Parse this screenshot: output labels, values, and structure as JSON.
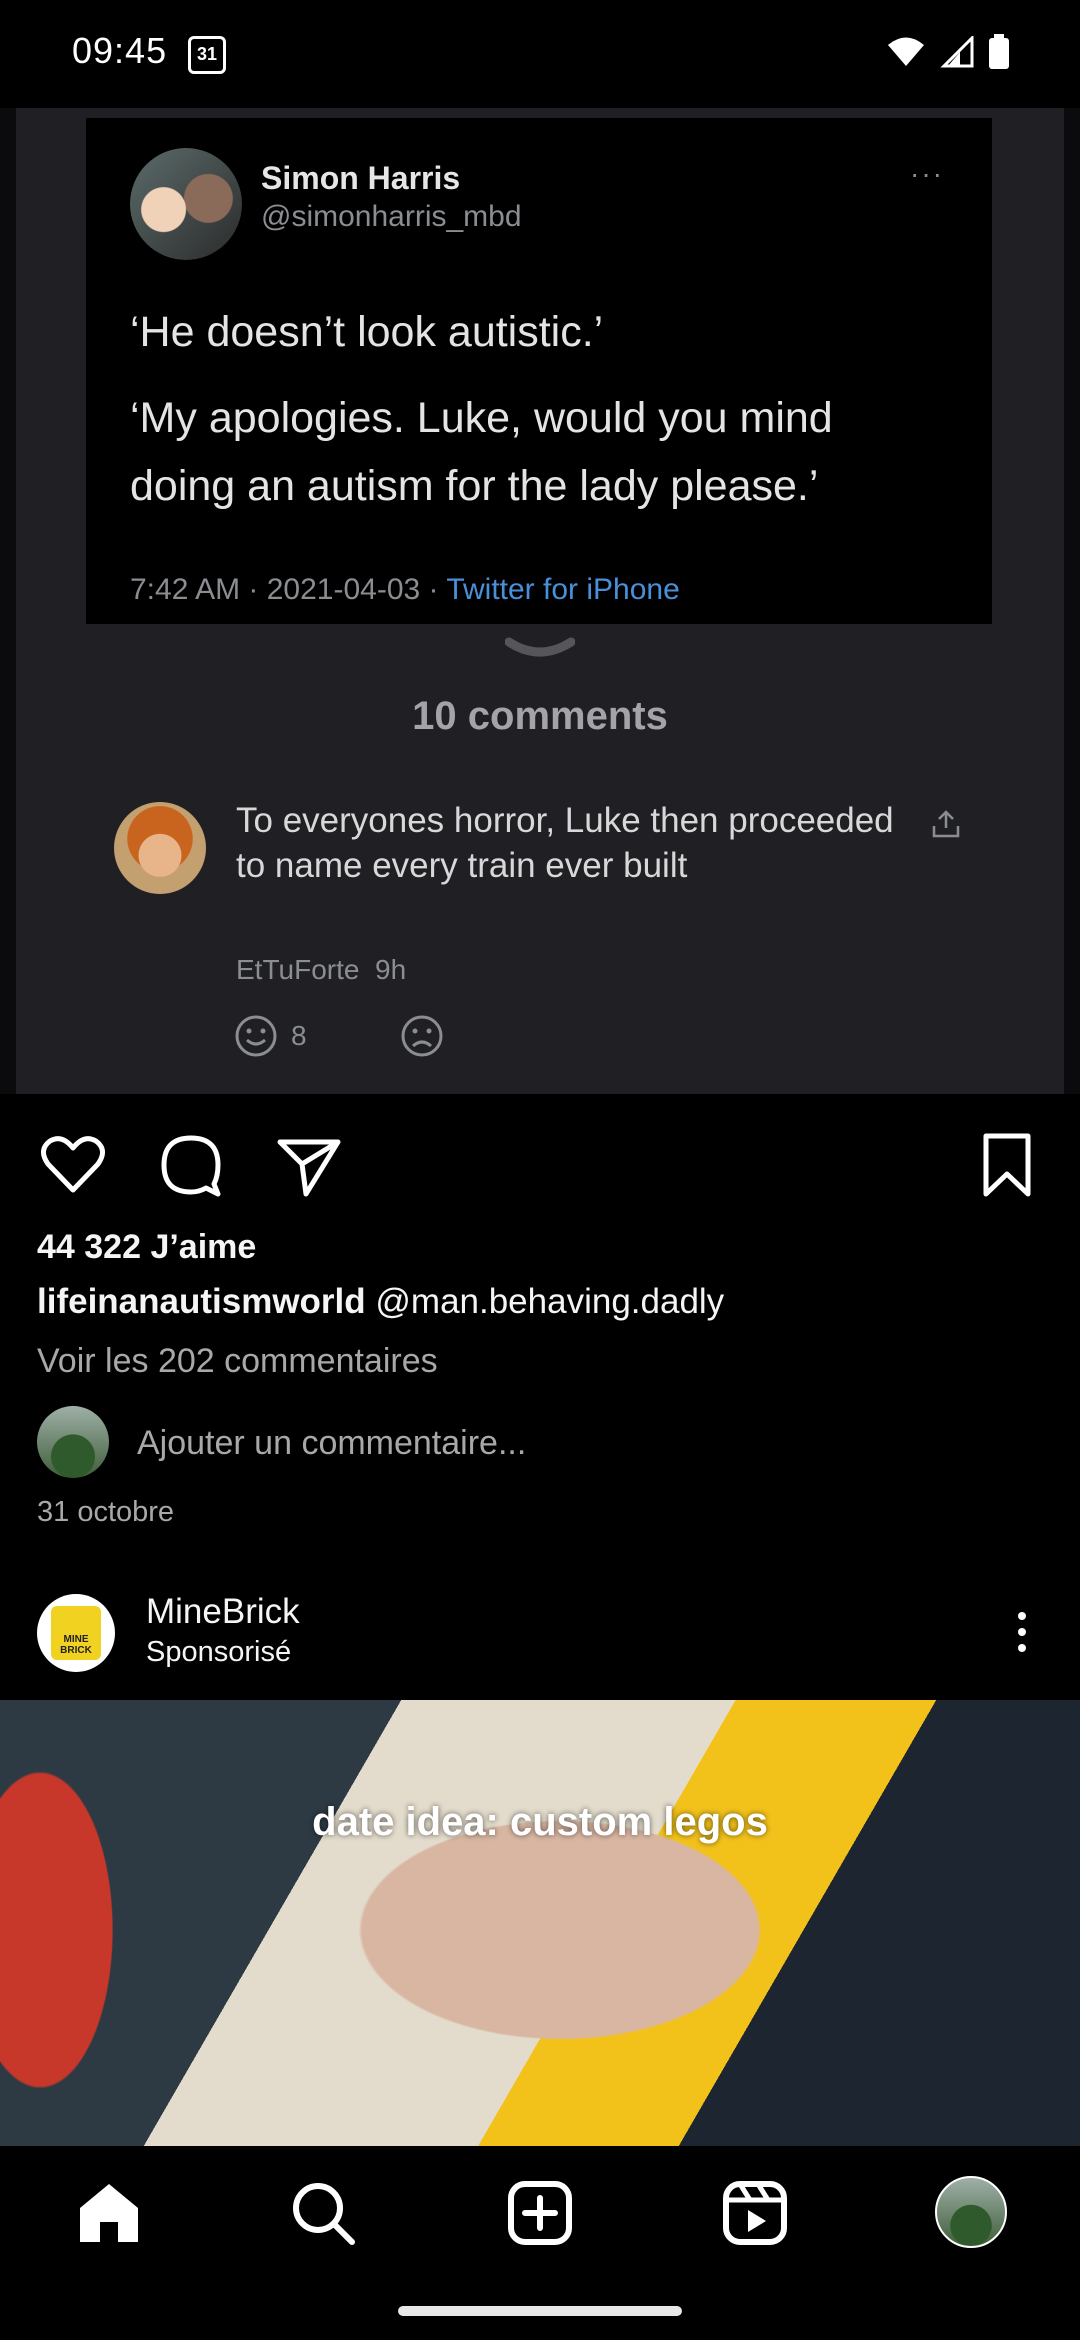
{
  "status_bar": {
    "time": "09:45",
    "calendar_day": "31"
  },
  "post": {
    "tweet": {
      "name": "Simon Harris",
      "handle": "@simonharris_mbd",
      "more": "···",
      "line1": "‘He doesn’t look autistic.’",
      "line2": "‘My apologies. Luke, would you mind",
      "line3": "doing an autism for the lady please.’",
      "meta": "7:42 AM · 2021-04-03 · ",
      "source": "Twitter for iPhone"
    },
    "comments_count": "10 comments",
    "comment": {
      "text": "To everyones horror, Luke then proceeded to name every train ever built",
      "author": "EtTuForte",
      "age": "9h",
      "happy_count": "8"
    },
    "likes": "44 322 J’aime",
    "caption_user": "lifeinanautismworld",
    "caption_text": " @man.behaving.dadly",
    "view_comments": "Voir les 202 commentaires",
    "add_comment_placeholder": "Ajouter un commentaire...",
    "date": "31 octobre"
  },
  "sponsored": {
    "name": "MineBrick",
    "label": "Sponsorisé",
    "logo_text": "MINE BRICK",
    "overlay": "date idea: custom legos"
  },
  "icons": {
    "like": "heart-icon",
    "comment": "comment-icon",
    "share": "send-icon",
    "save": "bookmark-icon"
  },
  "colors": {
    "background": "#000000",
    "link_blue": "#4a90d9",
    "muted": "#a8a8a8"
  }
}
